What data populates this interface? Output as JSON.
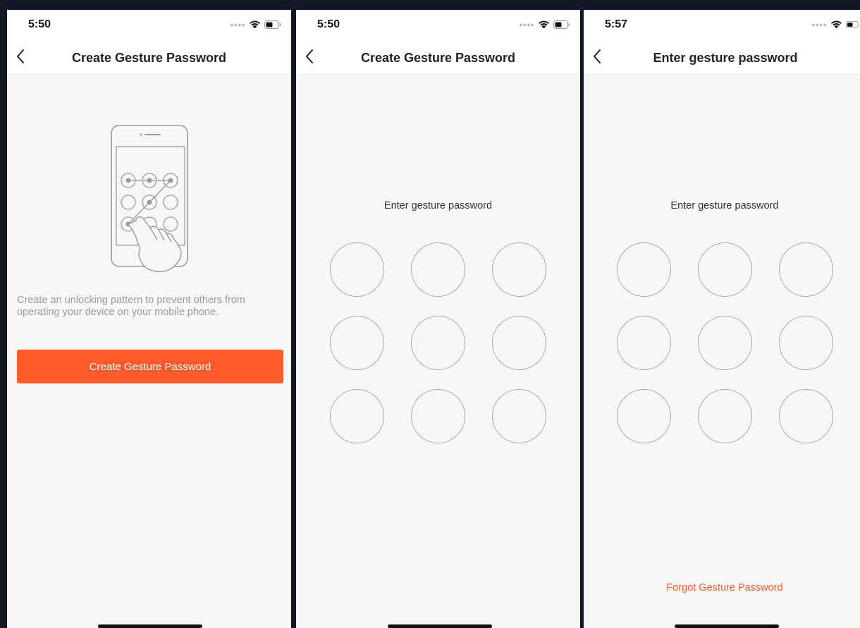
{
  "screens": [
    {
      "time": "5:50",
      "title": "Create Gesture Password",
      "description": "Create an unlocking pattern to prevent others from operating your device on your mobile phone.",
      "button_label": "Create Gesture Password"
    },
    {
      "time": "5:50",
      "title": "Create Gesture Password",
      "prompt": "Enter gesture password"
    },
    {
      "time": "5:57",
      "title": "Enter gesture password",
      "prompt": "Enter gesture password",
      "forgot_label": "Forgot Gesture Password"
    }
  ],
  "icons": {
    "back": "chevron-left-icon",
    "signal": "signal-icon",
    "wifi": "wifi-icon",
    "battery": "battery-icon",
    "illustration": "phone-gesture-illustration"
  },
  "colors": {
    "accent": "#ff5a28",
    "background": "#f7f7f7",
    "frame": "#101828"
  }
}
